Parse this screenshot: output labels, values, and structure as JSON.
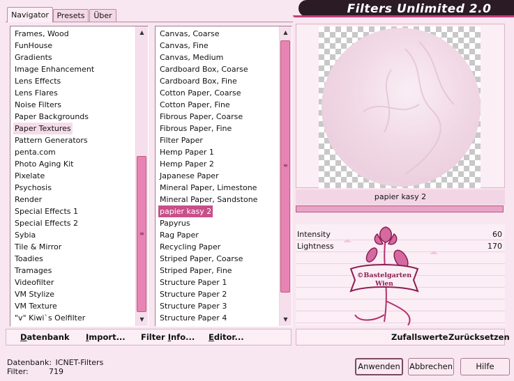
{
  "app": {
    "title": "Filters Unlimited 2.0"
  },
  "tabs": [
    {
      "label": "Navigator",
      "active": true
    },
    {
      "label": "Presets",
      "active": false
    },
    {
      "label": "Über",
      "active": false
    }
  ],
  "categories": {
    "items": [
      "Frames, Wood",
      "FunHouse",
      "Gradients",
      "Image Enhancement",
      "Lens Effects",
      "Lens Flares",
      "Noise Filters",
      "Paper Backgrounds",
      "Paper Textures",
      "Pattern Generators",
      "penta.com",
      "Photo Aging Kit",
      "Pixelate",
      "Psychosis",
      "Render",
      "Special Effects 1",
      "Special Effects 2",
      "Sybia",
      "Tile & Mirror",
      "Toadies",
      "Tramages",
      "Videofilter",
      "VM Stylize",
      "VM Texture",
      "\"v\" Kiwi`s Oelfilter"
    ],
    "highlighted": "Paper Textures"
  },
  "filters": {
    "items": [
      "Canvas, Coarse",
      "Canvas, Fine",
      "Canvas, Medium",
      "Cardboard Box, Coarse",
      "Cardboard Box, Fine",
      "Cotton Paper, Coarse",
      "Cotton Paper, Fine",
      "Fibrous Paper, Coarse",
      "Fibrous Paper, Fine",
      "Filter Paper",
      "Hemp Paper 1",
      "Hemp Paper 2",
      "Japanese Paper",
      "Mineral Paper, Limestone",
      "Mineral Paper, Sandstone",
      "papier kasy 2",
      "Papyrus",
      "Rag Paper",
      "Recycling Paper",
      "Striped Paper, Coarse",
      "Striped Paper, Fine",
      "Structure Paper 1",
      "Structure Paper 2",
      "Structure Paper 3",
      "Structure Paper 4"
    ],
    "selected": "papier kasy 2"
  },
  "toolbar": {
    "database": "atenbank",
    "database_key": "D",
    "import": "mport...",
    "import_key": "I",
    "filter_info": "Filter ",
    "filter_info_key": "I",
    "filter_info_rest": "nfo...",
    "editor": "ditor...",
    "editor_key": "E"
  },
  "preview": {
    "filter_name": "papier kasy 2",
    "progress": 1.0
  },
  "params": [
    {
      "label": "Intensity",
      "value": "60",
      "level": 0.235
    },
    {
      "label": "Lightness",
      "value": "170",
      "level": 0.667
    }
  ],
  "actions": {
    "randomize": "Zufallswerte",
    "reset": "Zurücksetzen"
  },
  "status": {
    "database_label": "Datenbank:",
    "database_value": "ICNET-Filters",
    "filter_label": "Filter:",
    "filter_value": "719"
  },
  "watermark": {
    "line1": "©Bastelgarten",
    "line2": "Wien"
  },
  "buttons": {
    "apply": "Anwenden",
    "cancel": "Abbrechen",
    "help": "Hilfe"
  },
  "colors": {
    "accent": "#c84f8a",
    "background": "#f8e6f0",
    "banner": "#2b1b24"
  }
}
